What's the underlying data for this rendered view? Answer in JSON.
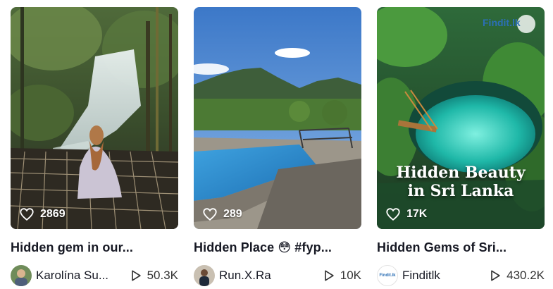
{
  "cards": [
    {
      "likes": "2869",
      "title": "Hidden gem in our...",
      "author": "Karolína Su...",
      "views": "50.3K",
      "thumbnail_icon": "waterfall-forest-photo"
    },
    {
      "likes": "289",
      "title": "Hidden Place 😳 #fyp...",
      "author": "Run.X.Ra",
      "views": "10K",
      "thumbnail_icon": "pool-mountain-photo"
    },
    {
      "likes": "17K",
      "title": "Hidden Gems of Sri...",
      "author": "Finditlk",
      "views": "430.2K",
      "thumbnail_icon": "lagoon-cave-photo",
      "overlay_line1": "Hidden Beauty",
      "overlay_line2": "in Sri Lanka",
      "logo_text": "Findit.lk",
      "avatar_text": "Findit.lk"
    }
  ],
  "icons": {
    "like": "heart-outline-icon",
    "views": "play-outline-icon"
  },
  "colors": {
    "text": "#161823",
    "overlay_text": "#ffffff"
  }
}
